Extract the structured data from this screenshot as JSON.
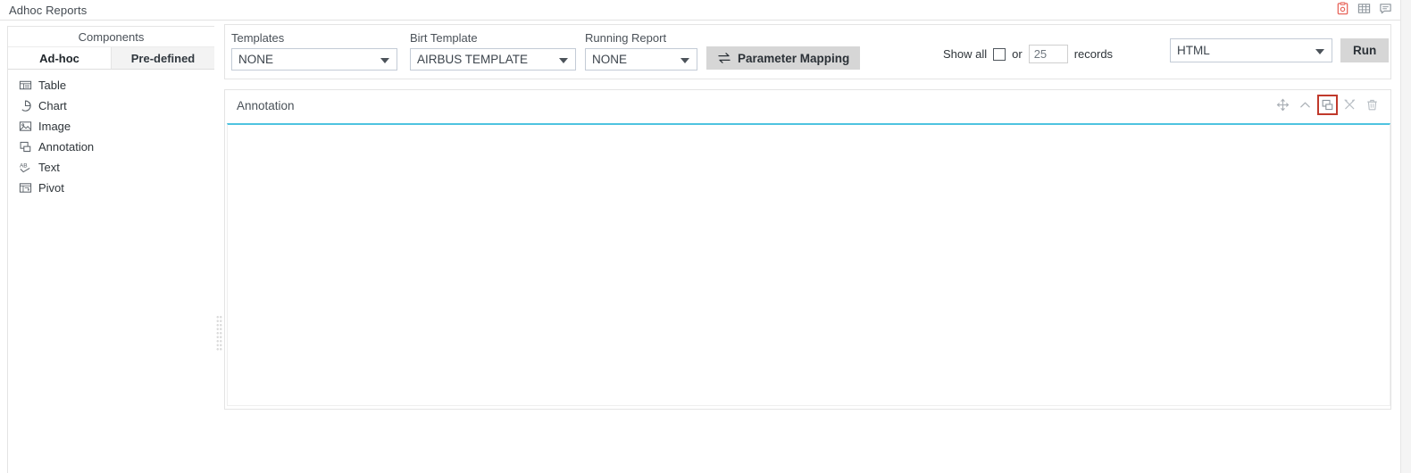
{
  "window": {
    "title": "Adhoc Reports",
    "titlebar_icons": [
      {
        "name": "save-report-icon",
        "color": "#e8685e"
      },
      {
        "name": "grid-table-icon",
        "color": "#8d959c"
      },
      {
        "name": "comment-icon",
        "color": "#8d959c"
      }
    ]
  },
  "sidebar": {
    "header": "Components",
    "tabs": [
      {
        "label": "Ad-hoc",
        "active": true
      },
      {
        "label": "Pre-defined",
        "active": false
      }
    ],
    "items": [
      {
        "label": "Table",
        "icon": "table-icon"
      },
      {
        "label": "Chart",
        "icon": "pie-chart-icon"
      },
      {
        "label": "Image",
        "icon": "image-icon"
      },
      {
        "label": "Annotation",
        "icon": "annotation-icon"
      },
      {
        "label": "Text",
        "icon": "text-ab-icon"
      },
      {
        "label": "Pivot",
        "icon": "pivot-icon"
      }
    ]
  },
  "toolbar": {
    "templates": {
      "label": "Templates",
      "value": "NONE",
      "options": [
        "NONE"
      ]
    },
    "birt_template": {
      "label": "Birt Template",
      "value": "AIRBUS TEMPLATE",
      "options": [
        "AIRBUS TEMPLATE"
      ]
    },
    "running_report": {
      "label": "Running Report",
      "value": "NONE",
      "options": [
        "NONE"
      ]
    },
    "parameter_mapping": {
      "label": "Parameter Mapping",
      "icon": "swap-arrows-icon"
    },
    "records": {
      "show_all_label": "Show all",
      "or_label": "or",
      "records_label": "records",
      "value": "25",
      "show_all_checked": false
    },
    "format": {
      "value": "HTML",
      "options": [
        "HTML"
      ]
    },
    "run": {
      "label": "Run"
    }
  },
  "annotation_panel": {
    "title": "Annotation",
    "accent_color": "#4ec3e0",
    "highlight_color": "#c0392b",
    "content": "",
    "tools": [
      {
        "name": "move-handle-icon",
        "title": "Move",
        "highlighted": false
      },
      {
        "name": "chevron-up-icon",
        "title": "Collapse",
        "highlighted": false
      },
      {
        "name": "annotation-edit-icon",
        "title": "Edit annotation",
        "highlighted": true
      },
      {
        "name": "settings-tools-icon",
        "title": "Settings",
        "highlighted": false
      },
      {
        "name": "trash-icon",
        "title": "Delete",
        "highlighted": false
      }
    ]
  }
}
